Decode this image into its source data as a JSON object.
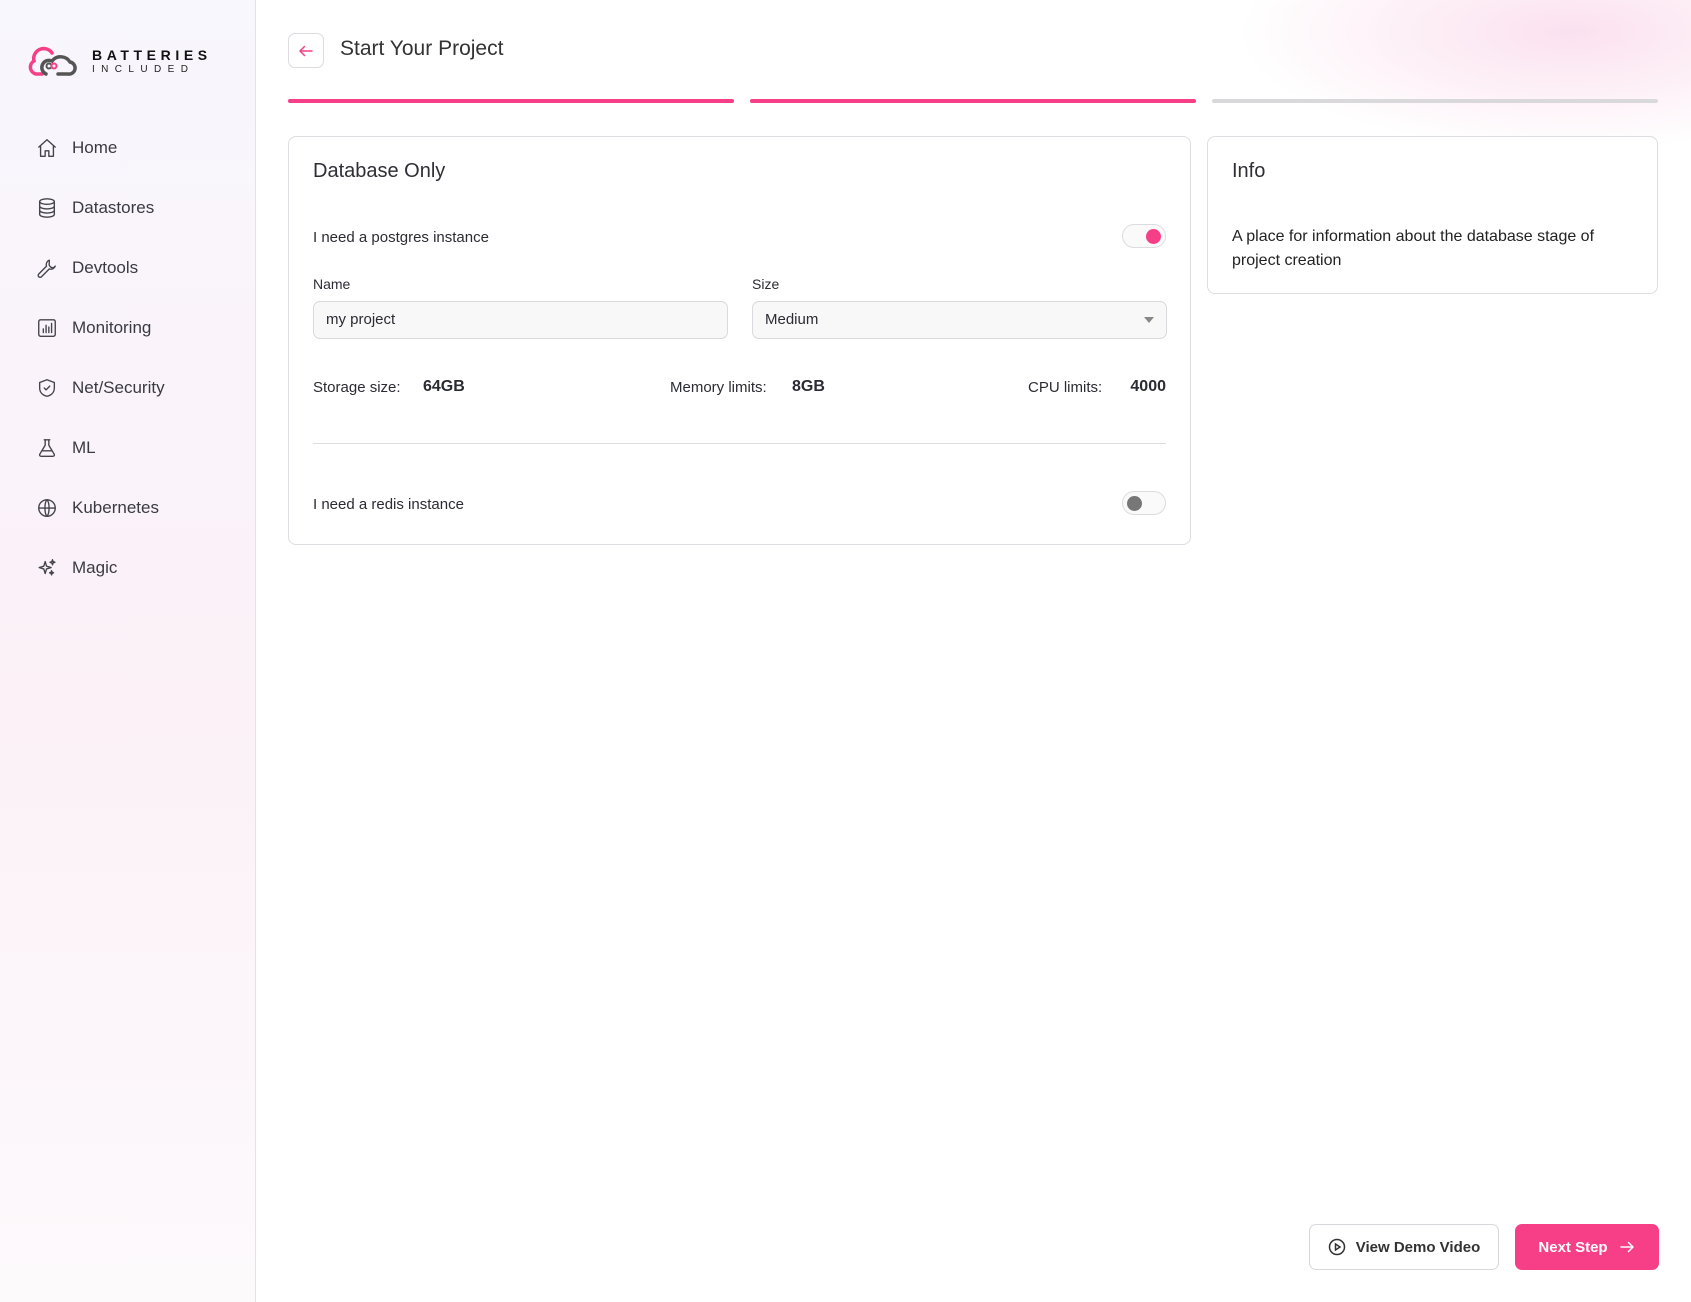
{
  "brand": {
    "line1": "BATTERIES",
    "line2": "INCLUDED"
  },
  "sidebar": {
    "items": [
      {
        "label": "Home",
        "icon": "home-icon"
      },
      {
        "label": "Datastores",
        "icon": "database-icon"
      },
      {
        "label": "Devtools",
        "icon": "wrench-icon"
      },
      {
        "label": "Monitoring",
        "icon": "chart-icon"
      },
      {
        "label": "Net/Security",
        "icon": "shield-icon"
      },
      {
        "label": "ML",
        "icon": "flask-icon"
      },
      {
        "label": "Kubernetes",
        "icon": "globe-icon"
      },
      {
        "label": "Magic",
        "icon": "sparkles-icon"
      }
    ]
  },
  "header": {
    "title": "Start Your Project"
  },
  "progress": {
    "steps_total": 3,
    "steps_completed": 2
  },
  "colors": {
    "accent": "#f63f86",
    "inactive": "#d9d9dc"
  },
  "form": {
    "title": "Database Only",
    "postgres_label": "I need a postgres instance",
    "postgres_on": true,
    "name_label": "Name",
    "name_value": "my project",
    "size_label": "Size",
    "size_value": "Medium",
    "storage_label": "Storage size:",
    "storage_value": "64GB",
    "memory_label": "Memory limits:",
    "memory_value": "8GB",
    "cpu_label": "CPU limits:",
    "cpu_value": "4000",
    "redis_label": "I need a redis instance",
    "redis_on": false
  },
  "info": {
    "title": "Info",
    "text": "A place for information about the database stage of project creation"
  },
  "footer": {
    "demo_label": "View Demo Video",
    "next_label": "Next Step"
  }
}
